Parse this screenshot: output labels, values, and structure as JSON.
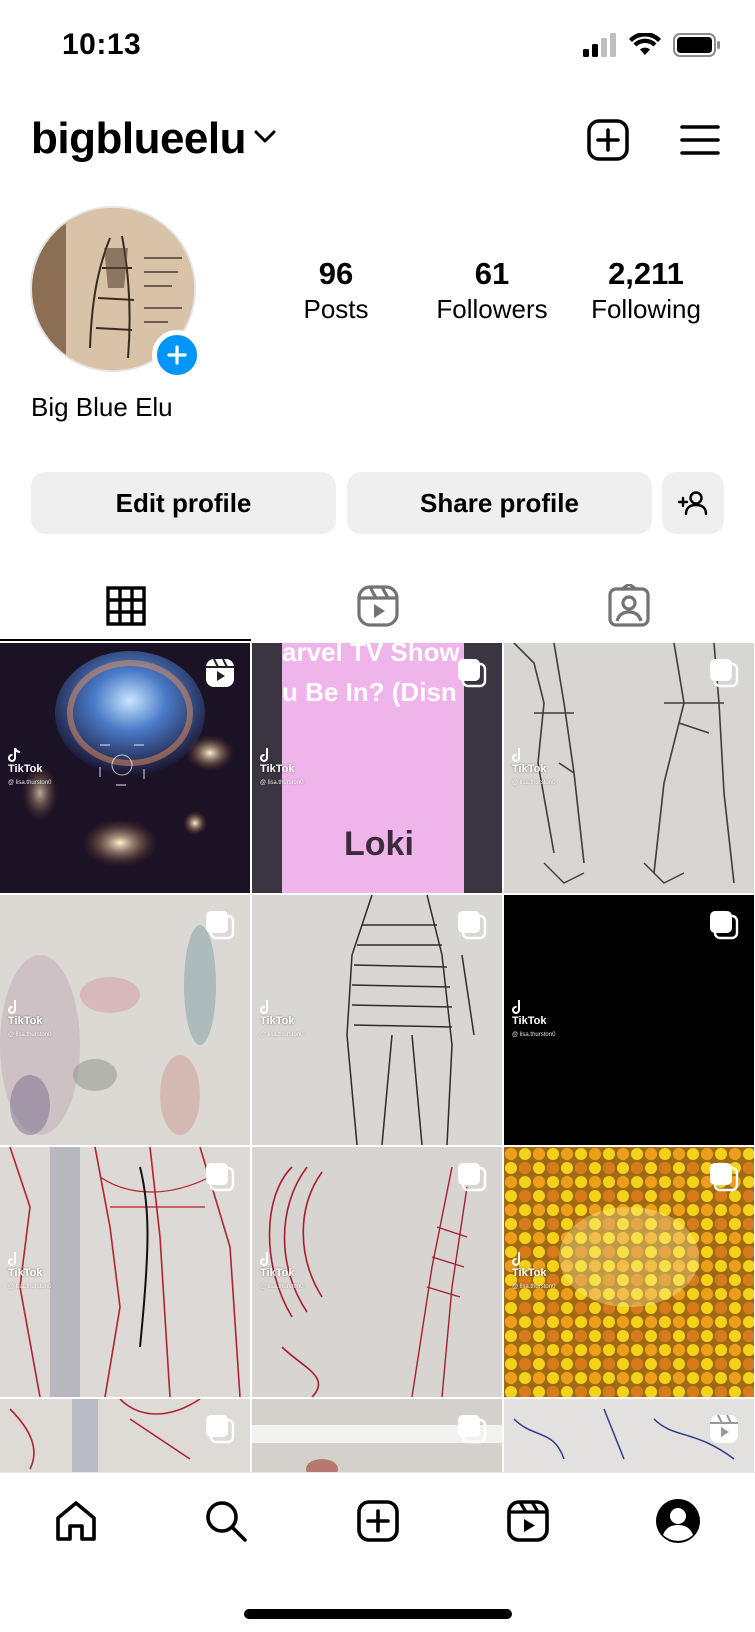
{
  "status_bar": {
    "time": "10:13",
    "icons": [
      "signal-icon",
      "wifi-icon",
      "battery-icon"
    ]
  },
  "header": {
    "username": "bigblueelu",
    "actions": [
      "create-post-icon",
      "menu-icon"
    ]
  },
  "profile": {
    "display_name": "Big Blue Elu",
    "stats": [
      {
        "value": "96",
        "label": "Posts"
      },
      {
        "value": "61",
        "label": "Followers"
      },
      {
        "value": "2,211",
        "label": "Following"
      }
    ]
  },
  "actions": {
    "edit_label": "Edit profile",
    "share_label": "Share profile"
  },
  "tabs": [
    "grid-icon",
    "reels-icon",
    "tagged-icon"
  ],
  "grid": {
    "tiktok_label": "TikTok",
    "tiktok_handle": "@ lisa.thurston0",
    "posts": [
      {
        "badge": "reel-icon",
        "overlay": ""
      },
      {
        "badge": "carousel-icon",
        "overlay_top": "arvel TV Show",
        "overlay_mid": "u Be In? (Disn",
        "overlay_bottom": "Loki"
      },
      {
        "badge": "carousel-icon"
      },
      {
        "badge": "carousel-icon"
      },
      {
        "badge": "carousel-icon"
      },
      {
        "badge": "carousel-icon"
      },
      {
        "badge": "carousel-icon"
      },
      {
        "badge": "carousel-icon"
      },
      {
        "badge": "carousel-icon"
      },
      {
        "badge": "carousel-icon"
      },
      {
        "badge": "carousel-icon"
      },
      {
        "badge": "reel-icon"
      }
    ]
  },
  "bottom_nav": [
    "home-icon",
    "search-icon",
    "create-icon",
    "reels-icon",
    "profile-icon"
  ],
  "colors": {
    "accent": "#0095f6",
    "button_bg": "#efefef"
  }
}
